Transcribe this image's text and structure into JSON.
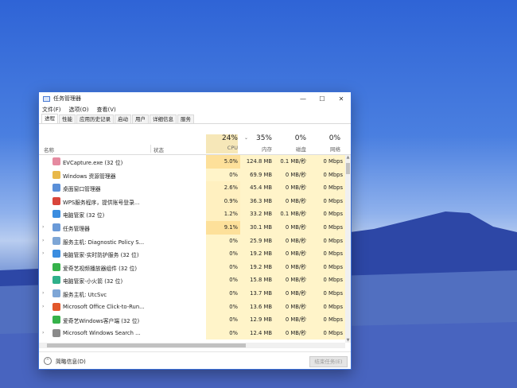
{
  "window": {
    "title": "任务管理器",
    "controls": {
      "minimize": "—",
      "maximize": "☐",
      "close": "✕"
    }
  },
  "menu": [
    "文件(F)",
    "选项(O)",
    "查看(V)"
  ],
  "tabs": [
    "进程",
    "性能",
    "应用历史记录",
    "启动",
    "用户",
    "详细信息",
    "服务"
  ],
  "active_tab": "进程",
  "columns": {
    "name": "名称",
    "status": "状态",
    "cpu": {
      "pct": "24%",
      "label": "CPU"
    },
    "memory": {
      "pct": "35%",
      "label": "内存"
    },
    "disk": {
      "pct": "0%",
      "label": "磁盘"
    },
    "network": {
      "pct": "0%",
      "label": "网络"
    }
  },
  "processes": [
    {
      "name": "EVCapture.exe (32 位)",
      "expandable": false,
      "icon_color": "#e58aa0",
      "cpu": "5.0%",
      "mem": "124.8 MB",
      "disk": "0.1 MB/秒",
      "net": "0 Mbps"
    },
    {
      "name": "Windows 资源管理器",
      "expandable": false,
      "icon_color": "#e8b84a",
      "cpu": "0%",
      "mem": "69.9 MB",
      "disk": "0 MB/秒",
      "net": "0 Mbps"
    },
    {
      "name": "桌面窗口管理器",
      "expandable": false,
      "icon_color": "#5a8fd8",
      "cpu": "2.6%",
      "mem": "45.4 MB",
      "disk": "0 MB/秒",
      "net": "0 Mbps"
    },
    {
      "name": "WPS服务程序，提供账号登录...",
      "expandable": false,
      "icon_color": "#d9453b",
      "cpu": "0.9%",
      "mem": "36.3 MB",
      "disk": "0 MB/秒",
      "net": "0 Mbps"
    },
    {
      "name": "电脑管家 (32 位)",
      "expandable": false,
      "icon_color": "#3b8de0",
      "cpu": "1.2%",
      "mem": "33.2 MB",
      "disk": "0.1 MB/秒",
      "net": "0 Mbps"
    },
    {
      "name": "任务管理器",
      "expandable": true,
      "icon_color": "#6a9ad8",
      "cpu": "9.1%",
      "mem": "30.1 MB",
      "disk": "0 MB/秒",
      "net": "0 Mbps"
    },
    {
      "name": "服务主机: Diagnostic Policy S...",
      "expandable": true,
      "icon_color": "#7ea6d6",
      "cpu": "0%",
      "mem": "25.9 MB",
      "disk": "0 MB/秒",
      "net": "0 Mbps"
    },
    {
      "name": "电脑管家-实时防护服务 (32 位)",
      "expandable": true,
      "icon_color": "#3b8de0",
      "cpu": "0%",
      "mem": "19.2 MB",
      "disk": "0 MB/秒",
      "net": "0 Mbps"
    },
    {
      "name": "爱奇艺视频播放器组件 (32 位)",
      "expandable": false,
      "icon_color": "#35b24a",
      "cpu": "0%",
      "mem": "19.2 MB",
      "disk": "0 MB/秒",
      "net": "0 Mbps"
    },
    {
      "name": "电脑管家-小火箭 (32 位)",
      "expandable": false,
      "icon_color": "#2fb08a",
      "cpu": "0%",
      "mem": "15.8 MB",
      "disk": "0 MB/秒",
      "net": "0 Mbps"
    },
    {
      "name": "服务主机: UtcSvc",
      "expandable": true,
      "icon_color": "#7ea6d6",
      "cpu": "0%",
      "mem": "13.7 MB",
      "disk": "0 MB/秒",
      "net": "0 Mbps"
    },
    {
      "name": "Microsoft Office Click-to-Run...",
      "expandable": true,
      "icon_color": "#e2572b",
      "cpu": "0%",
      "mem": "13.6 MB",
      "disk": "0 MB/秒",
      "net": "0 Mbps"
    },
    {
      "name": "爱奇艺Windows客户端 (32 位)",
      "expandable": false,
      "icon_color": "#35b24a",
      "cpu": "0%",
      "mem": "12.9 MB",
      "disk": "0 MB/秒",
      "net": "0 Mbps"
    },
    {
      "name": "Microsoft Windows Search ...",
      "expandable": true,
      "icon_color": "#8a8a8a",
      "cpu": "0%",
      "mem": "12.4 MB",
      "disk": "0 MB/秒",
      "net": "0 Mbps"
    }
  ],
  "footer": {
    "less_details": "简略信息(D)",
    "end_task": "结束任务(E)"
  },
  "colors": {
    "cpu_hot": "#fde09a",
    "cpu_warm": "#fff0c0",
    "cell_bg": "#fff4c9"
  }
}
